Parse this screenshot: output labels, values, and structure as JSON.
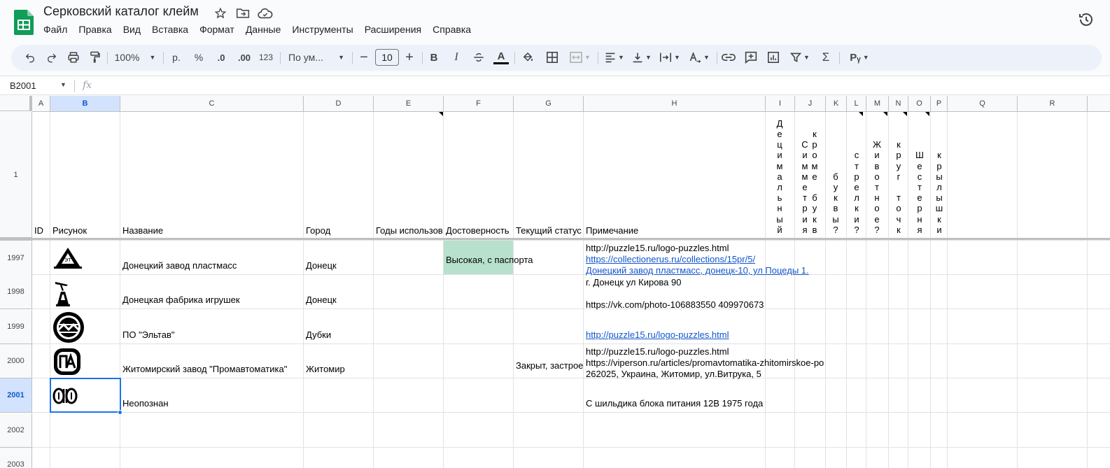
{
  "app": {
    "doc_title": "Серковский каталог клейм",
    "title_icons": [
      "star-icon",
      "move-to-folder-icon",
      "cloud-saved-icon"
    ],
    "menu": [
      "Файл",
      "Правка",
      "Вид",
      "Вставка",
      "Формат",
      "Данные",
      "Инструменты",
      "Расширения",
      "Справка"
    ]
  },
  "toolbar": {
    "zoom": "100%",
    "currency": "р.",
    "percent": "%",
    "dec_decrease": ".0",
    "dec_increase": ".00",
    "number_format": "123",
    "font": "По ум...",
    "font_size": "10",
    "bold": "B",
    "italic": "I",
    "text_color_letter": "A",
    "accent_color": "#000000",
    "icons": [
      "undo-icon",
      "redo-icon",
      "print-icon",
      "paint-format-icon",
      "font-size-decrease-icon",
      "font-size-increase-icon",
      "strikethrough-icon",
      "fill-color-icon",
      "borders-icon",
      "merge-cells-icon",
      "horizontal-align-icon",
      "vertical-align-icon",
      "text-wrapping-icon",
      "text-rotation-icon",
      "insert-link-icon",
      "insert-comment-icon",
      "insert-chart-icon",
      "filter-icon",
      "functions-icon",
      "input-tools-icon"
    ]
  },
  "formula_bar": {
    "cell_ref": "B2001",
    "fx": "fx",
    "value": ""
  },
  "columns": [
    "A",
    "B",
    "C",
    "D",
    "E",
    "F",
    "G",
    "H",
    "I",
    "J",
    "K",
    "L",
    "M",
    "N",
    "O",
    "P",
    "Q",
    "R"
  ],
  "selected_column": "B",
  "header_row": {
    "row_number": "1",
    "A": "ID",
    "B": "Рисунок",
    "C": "Название",
    "D": "Город",
    "E": "Годы использов",
    "F": "Достоверность",
    "G": "Текущий статус",
    "H": "Примечание",
    "I": "Децимальный",
    "J1": "Симметрия",
    "J2": "кроме букв",
    "K": "буквы?",
    "L": "стрелки?",
    "M": "Животное?",
    "N": "круг точк",
    "O": "Шестерня",
    "P": "крылышки"
  },
  "rows": [
    {
      "num": "1997",
      "image": "triangle-logo-image",
      "name": "Донецкий завод пластмасс",
      "city": "Донецк",
      "reliability": "Высокая, с паспорта",
      "reliability_color": "#b7e1cd",
      "status": "",
      "note_lines": [
        "http://puzzle15.ru/logo-puzzles.html",
        "https://collectionerus.ru/collections/15pr/5/",
        "Донецкий завод пластмасс, донецк-10, ул Поцеды 1."
      ]
    },
    {
      "num": "1998",
      "image": "airplane-monument-logo-image",
      "name": "Донецкая фабрика игрушек",
      "city": "Донецк",
      "reliability": "",
      "status": "",
      "note_lines": [
        "г. Донецк  ул Кирова 90",
        "",
        "https://vk.com/photo-106883550  409970673"
      ]
    },
    {
      "num": "1999",
      "image": "eltav-round-logo-image",
      "name": "ПО \"Эльтав\"",
      "city": "Дубки",
      "reliability": "",
      "status": "",
      "note_lines": [
        "http://puzzle15.ru/logo-puzzles.html"
      ]
    },
    {
      "num": "2000",
      "image": "pa-monogram-logo-image",
      "name": "Житомирский завод \"Промавтоматика\"",
      "city": "Житомир",
      "reliability": "",
      "status": "Закрыт, застрое",
      "note_lines": [
        "http://puzzle15.ru/logo-puzzles.html",
        "https://viperson.ru/articles/promavtomatika-zhitomirskoe-po",
        "262025, Украина, Житомир, ул.Витрука, 5"
      ]
    },
    {
      "num": "2001",
      "image": "unidentified-ornament-logo-image",
      "name": "Неопознан",
      "city": "",
      "reliability": "",
      "status": "",
      "note_lines": [
        "С шильдика блока питания 12В 1975 года"
      ]
    },
    {
      "num": "2002",
      "image": "",
      "name": "",
      "city": "",
      "reliability": "",
      "status": "",
      "note_lines": []
    },
    {
      "num": "2003",
      "image": "",
      "name": "",
      "city": "",
      "reliability": "",
      "status": "",
      "note_lines": []
    }
  ],
  "selected_row": "2001"
}
